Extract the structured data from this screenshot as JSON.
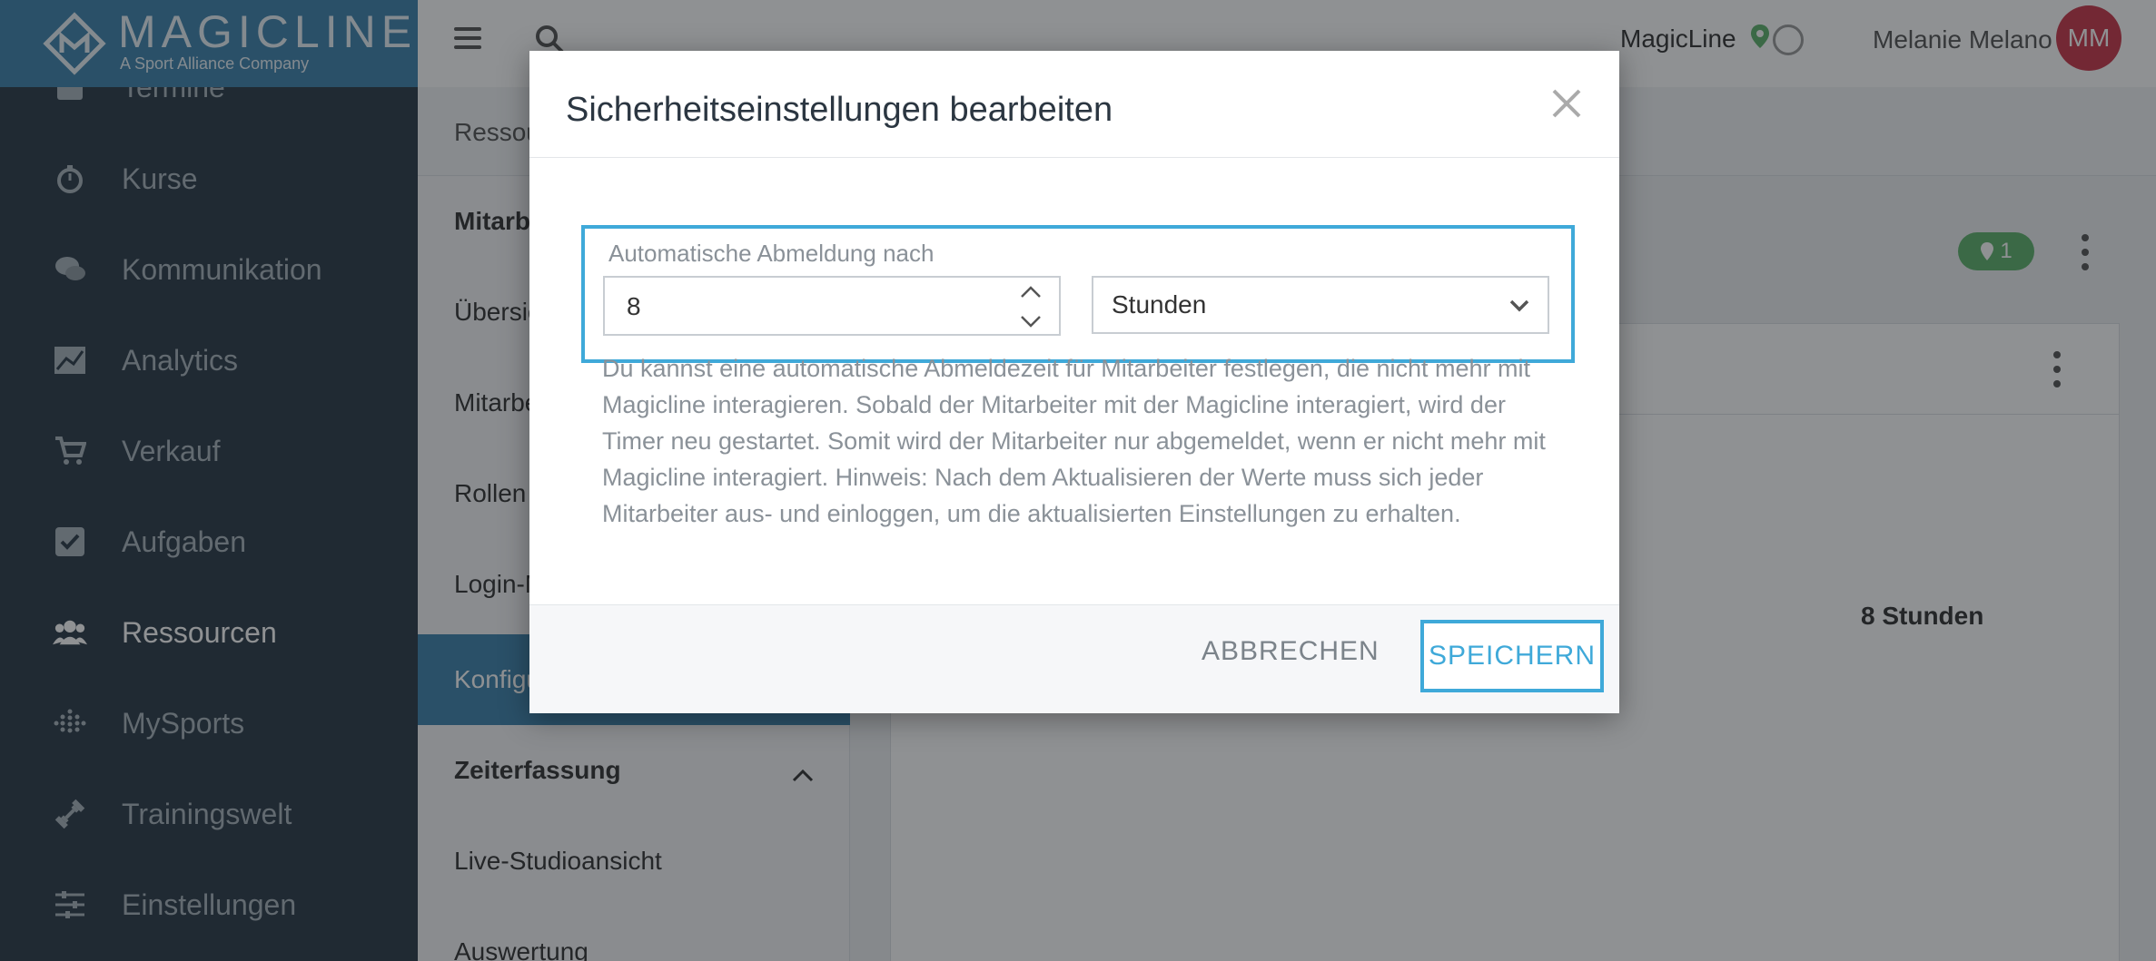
{
  "brand": {
    "name": "MAGICLINE",
    "tagline": "A Sport Alliance Company"
  },
  "sidebar": {
    "items": [
      {
        "label": "Termine",
        "icon": "calendar-icon"
      },
      {
        "label": "Kurse",
        "icon": "stopwatch-icon"
      },
      {
        "label": "Kommunikation",
        "icon": "chat-icon"
      },
      {
        "label": "Analytics",
        "icon": "chart-icon"
      },
      {
        "label": "Verkauf",
        "icon": "cart-icon"
      },
      {
        "label": "Aufgaben",
        "icon": "checkbox-icon"
      },
      {
        "label": "Ressourcen",
        "icon": "users-icon",
        "active": true
      },
      {
        "label": "MySports",
        "icon": "dots-grid-icon"
      },
      {
        "label": "Trainingswelt",
        "icon": "dumbbell-icon"
      },
      {
        "label": "Einstellungen",
        "icon": "sliders-icon"
      }
    ]
  },
  "topbar": {
    "location": "MagicLine",
    "user_name": "Melanie Melano",
    "avatar_initials": "MM"
  },
  "crumb": "Ressou",
  "subnav": {
    "items": [
      {
        "label": "Mitarbe",
        "bold": true
      },
      {
        "label": "Übersic"
      },
      {
        "label": "Mitarbe"
      },
      {
        "label": "Rollen"
      },
      {
        "label": "Login-M"
      },
      {
        "label": "Konfigu",
        "active": true
      },
      {
        "label": "Zeiterfassung",
        "bold": true
      },
      {
        "label": "Live-Studioansicht"
      },
      {
        "label": "Auswertung"
      }
    ]
  },
  "content": {
    "badge_count": "1",
    "value": "8 Stunden"
  },
  "modal": {
    "title": "Sicherheitseinstellungen bearbeiten",
    "field_label": "Automatische Abmeldung nach",
    "number_value": "8",
    "unit_value": "Stunden",
    "help_text": "Du kannst eine automatische Abmeldezeit für Mitarbeiter festlegen, die nicht mehr mit Magicline interagieren. Sobald der Mitarbeiter mit der Magicline interagiert, wird der Timer neu gestartet. Somit wird der Mitarbeiter nur abgemeldet, wenn er nicht mehr mit Magicline interagiert. Hinweis: Nach dem Aktualisieren der Werte muss sich jeder Mitarbeiter aus- und einloggen, um die aktualisierten Einstellungen zu erhalten.",
    "cancel_label": "ABBRECHEN",
    "save_label": "SPEICHERN"
  },
  "colors": {
    "accent": "#3fa9d9",
    "sidebar": "#2b3a47",
    "brand": "#3f83ad",
    "badge": "#5fb36c",
    "avatar": "#c9374a"
  }
}
